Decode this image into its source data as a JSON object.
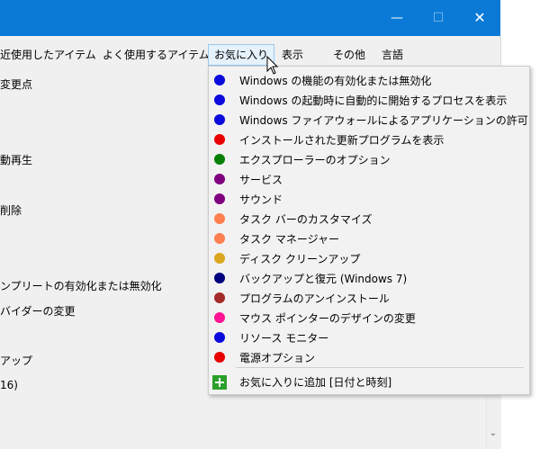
{
  "titlebar": {
    "minimize": "—",
    "maximize": "☐",
    "close": "✕"
  },
  "menubar": {
    "items": [
      {
        "label": "近使用したアイテム"
      },
      {
        "label": "よく使用するアイテム"
      },
      {
        "label": "お気に入り"
      },
      {
        "label": "表示"
      },
      {
        "label": "その他"
      },
      {
        "label": "言語"
      }
    ]
  },
  "background_list": [
    {
      "label": "変更点"
    },
    {
      "label": "動再生"
    },
    {
      "label": "削除"
    },
    {
      "label": "ンプリートの有効化または無効化"
    },
    {
      "label": "バイダーの変更"
    },
    {
      "label": "アップ"
    },
    {
      "label": "16)"
    }
  ],
  "favorites_menu": {
    "items": [
      {
        "label": "Windows の機能の有効化または無効化",
        "color": "#0a0adc"
      },
      {
        "label": "Windows の起動時に自動的に開始するプロセスを表示",
        "color": "#0a0adc"
      },
      {
        "label": "Windows ファイアウォールによるアプリケーションの許可",
        "color": "#0a0adc"
      },
      {
        "label": "インストールされた更新プログラムを表示",
        "color": "#e80000"
      },
      {
        "label": "エクスプローラーのオプション",
        "color": "#088008"
      },
      {
        "label": "サービス",
        "color": "#800080"
      },
      {
        "label": "サウンド",
        "color": "#800080"
      },
      {
        "label": "タスク バーのカスタマイズ",
        "color": "#ff7f50"
      },
      {
        "label": "タスク マネージャー",
        "color": "#ff7f50"
      },
      {
        "label": "ディスク クリーンアップ",
        "color": "#daa520"
      },
      {
        "label": "バックアップと復元 (Windows 7)",
        "color": "#00007f"
      },
      {
        "label": "プログラムのアンインストール",
        "color": "#a52a2a"
      },
      {
        "label": "マウス ポインターのデザインの変更",
        "color": "#ff1493"
      },
      {
        "label": "リソース モニター",
        "color": "#0a0adc"
      },
      {
        "label": "電源オプション",
        "color": "#e80000"
      }
    ],
    "add_item": {
      "label": "お気に入りに追加 [日付と時刻]",
      "icon": "plus-icon",
      "color": "#2aa02a"
    }
  }
}
